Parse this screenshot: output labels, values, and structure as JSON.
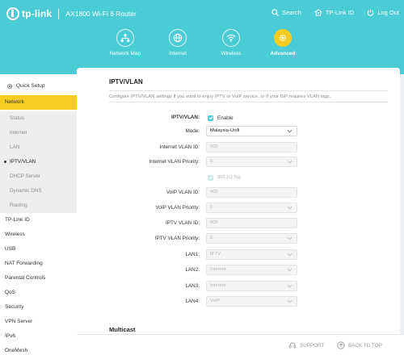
{
  "header": {
    "brand": "tp-link",
    "model": "AX1800 Wi-Fi 6 Router",
    "actions": [
      {
        "label": "Search",
        "icon": "search-icon"
      },
      {
        "label": "TP-Link ID",
        "icon": "id-icon"
      },
      {
        "label": "Log Out",
        "icon": "logout-icon"
      }
    ]
  },
  "nav": {
    "items": [
      {
        "label": "Network Map",
        "icon": "network-map-icon",
        "active": false
      },
      {
        "label": "Internet",
        "icon": "globe-icon",
        "active": false
      },
      {
        "label": "Wireless",
        "icon": "wifi-icon",
        "active": false
      },
      {
        "label": "Advanced",
        "icon": "gear-icon",
        "active": true
      }
    ]
  },
  "sidebar": {
    "quick_setup": "Quick Setup",
    "network": "Network",
    "network_sub": [
      "Status",
      "Internet",
      "LAN",
      "IPTV/VLAN",
      "DHCP Server",
      "Dynamic DNS",
      "Routing"
    ],
    "current_sub": "IPTV/VLAN",
    "items": [
      "TP-Link ID",
      "Wireless",
      "USB",
      "NAT Forwarding",
      "Parental Controls",
      "QoS",
      "Security",
      "VPN Server",
      "IPv6",
      "OneMesh"
    ]
  },
  "main": {
    "title": "IPTV/VLAN",
    "description": "Configure IPTV/VLAN settings if you want to enjoy IPTV or VoIP service, or if your ISP requires VLAN tags.",
    "iptv_label": "IPTV/VLAN:",
    "iptv_enable": "Enable",
    "mode_label": "Mode:",
    "mode_value": "Malaysia-Unifi",
    "internet_vlan_id_label": "Internet VLAN ID:",
    "internet_vlan_id": "500",
    "internet_vlan_priority_label": "Internet VLAN Priority:",
    "internet_vlan_priority": "0",
    "tag_label": "802.1Q Tag",
    "voip_vlan_id_label": "VoIP VLAN ID:",
    "voip_vlan_id": "400",
    "voip_vlan_priority_label": "VoIP VLAN Priority:",
    "voip_vlan_priority": "0",
    "iptv_vlan_id_label": "IPTV VLAN ID:",
    "iptv_vlan_id": "600",
    "iptv_vlan_priority_label": "IPTV VLAN Priority:",
    "iptv_vlan_priority": "0",
    "lan1_label": "LAN1:",
    "lan1": "IPTV",
    "lan2_label": "LAN2:",
    "lan2": "Internet",
    "lan3_label": "LAN3:",
    "lan3": "Internet",
    "lan4_label": "LAN4:",
    "lan4": "VoIP",
    "multicast_title": "Multicast"
  },
  "footer": {
    "support": "SUPPORT",
    "back_to_top": "BACK TO TOP"
  },
  "colors": {
    "header": "#4acbd6",
    "accent": "#f5cc1f",
    "checkbox": "#4acbd6"
  }
}
